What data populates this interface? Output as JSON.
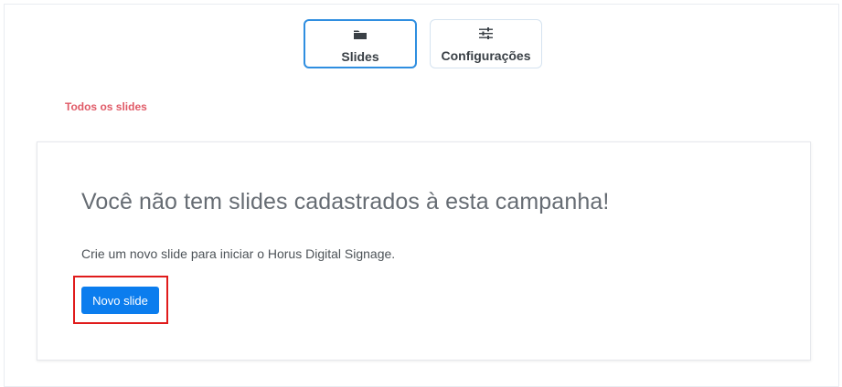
{
  "tabs": [
    {
      "label": "Slides",
      "icon": "folder-icon",
      "active": true
    },
    {
      "label": "Configurações",
      "icon": "sliders-icon",
      "active": false
    }
  ],
  "section": {
    "label": "Todos os slides"
  },
  "empty_state": {
    "title": "Você não tem slides cadastrados à esta campanha!",
    "description": "Crie um novo slide para iniciar o Horus Digital Signage.",
    "button_label": "Novo slide"
  },
  "colors": {
    "accent": "#0b7dee",
    "active_tab_border": "#2f8ee0",
    "section_label": "#e05a67",
    "highlight": "#e01b1b"
  }
}
